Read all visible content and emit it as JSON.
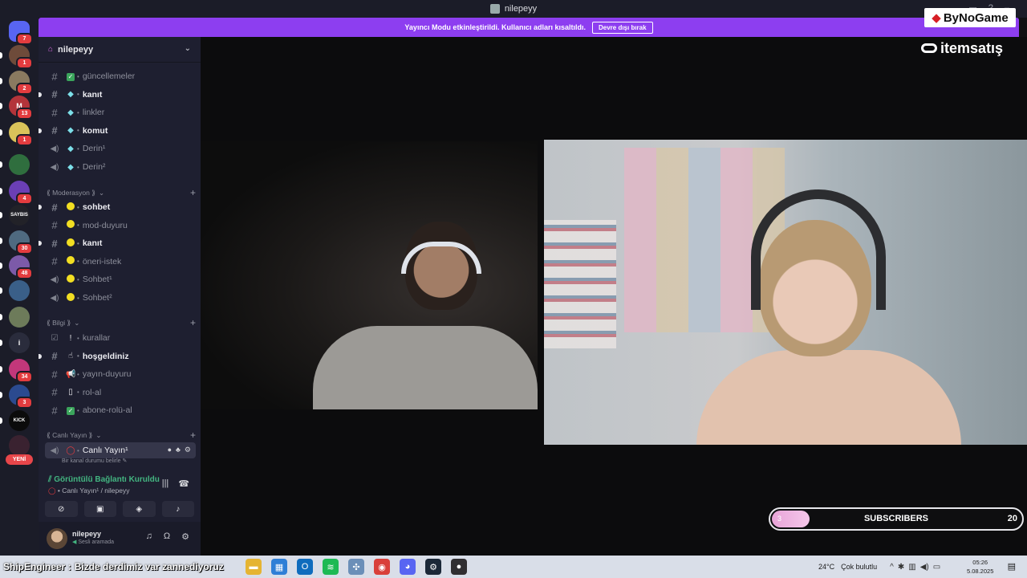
{
  "window": {
    "title": "nilepeyy"
  },
  "banner": {
    "message": "Yayıncı Modu etkinleştirildi. Kullanıcı adları kısaltıldı.",
    "button": "Devre dışı bırak"
  },
  "rail": {
    "servers": [
      {
        "initial": "",
        "badge": "7",
        "color": "#5865f2"
      },
      {
        "initial": "",
        "badge": "1",
        "color": "#6e4b3a"
      },
      {
        "initial": "",
        "badge": "2",
        "color": "#8a7a60"
      },
      {
        "initial": "M",
        "badge": "13",
        "color": "#b3343a"
      },
      {
        "initial": "",
        "badge": "1",
        "color": "#d9c35a"
      },
      {
        "initial": "",
        "badge": "",
        "color": "#2f6e3e"
      },
      {
        "initial": "",
        "badge": "4",
        "color": "#6b3fb5"
      },
      {
        "initial": "SAYBIS",
        "badge": "",
        "color": "#222228"
      },
      {
        "initial": "",
        "badge": "30",
        "color": "#4f6a80"
      },
      {
        "initial": "",
        "badge": "48",
        "color": "#7c5aa8"
      },
      {
        "initial": "",
        "badge": "",
        "color": "#3a5f88"
      },
      {
        "initial": "",
        "badge": "",
        "color": "#6d7b5a"
      },
      {
        "initial": "i",
        "badge": "",
        "color": "#2a2c3c"
      },
      {
        "initial": "",
        "badge": "34",
        "color": "#c2377a"
      },
      {
        "initial": "",
        "badge": "3",
        "color": "#2b4a8f"
      },
      {
        "initial": "KICK",
        "badge": "",
        "color": "#0b0b0b"
      },
      {
        "initial": "",
        "badge": "",
        "color": "#3a2230"
      }
    ],
    "new_label": "YENİ"
  },
  "sidebar": {
    "server_name": "nilepeyy",
    "channels_top": [
      {
        "name": "güncellemeler",
        "kind": "text",
        "emoji": "check",
        "bold": false
      },
      {
        "name": "kanıt",
        "kind": "text",
        "emoji": "gem",
        "bold": true
      },
      {
        "name": "linkler",
        "kind": "text",
        "emoji": "gem",
        "bold": false
      },
      {
        "name": "komut",
        "kind": "text",
        "emoji": "gem",
        "bold": true
      },
      {
        "name": "Derin¹",
        "kind": "voice",
        "emoji": "gem",
        "bold": false
      },
      {
        "name": "Derin²",
        "kind": "voice",
        "emoji": "gem",
        "bold": false
      }
    ],
    "categories": {
      "moderasyon": "⟪ Moderasyon ⟫",
      "bilgi": "⟪ Bilgi ⟫",
      "canli": "⟪ Canlı Yayın ⟫"
    },
    "channels_mod": [
      {
        "name": "sohbet",
        "kind": "text",
        "bold": true
      },
      {
        "name": "mod-duyuru",
        "kind": "text",
        "bold": false
      },
      {
        "name": "kanıt",
        "kind": "text",
        "bold": true
      },
      {
        "name": "öneri-istek",
        "kind": "text",
        "bold": false
      },
      {
        "name": "Sohbet¹",
        "kind": "voice",
        "bold": false
      },
      {
        "name": "Sohbet²",
        "kind": "voice",
        "bold": false
      }
    ],
    "channels_info": [
      {
        "name": "kurallar",
        "kind": "rules",
        "emoji": "!",
        "bold": false
      },
      {
        "name": "hoşgeldiniz",
        "kind": "text",
        "emoji": "☝",
        "bold": true
      },
      {
        "name": "yayın-duyuru",
        "kind": "text",
        "emoji": "📢",
        "bold": false
      },
      {
        "name": "rol-al",
        "kind": "text",
        "emoji": "▯",
        "bold": false
      },
      {
        "name": "abone-rolü-al",
        "kind": "text",
        "emoji": "check",
        "bold": false
      }
    ],
    "live_channel": {
      "name": "Canlı Yayın¹",
      "status": "Bir kanal durumu belirle"
    },
    "voice": {
      "title": "Görüntülü Bağlantı Kuruldu",
      "subtitle": "Canlı Yayın¹ / nilepeyy"
    },
    "user": {
      "name": "nilepeyy",
      "status": "Sesli aramada"
    }
  },
  "overlay": {
    "logo1": "ByNoGame",
    "logo2": "itemsatış",
    "subscribers": {
      "label": "SUBSCRIBERS",
      "current": 3,
      "goal": 20
    }
  },
  "taskbar": {
    "ticker_user": "ShipEngineer :",
    "ticker_text": "Bizde derdimiz var zannediyoruz",
    "weather_temp": "24°C",
    "weather_text": "Çok bulutlu",
    "time": "05:26",
    "date": "5.08.2025",
    "apps": [
      {
        "icon": "folder-icon",
        "color": "#e5b432",
        "glyph": "▬"
      },
      {
        "icon": "store-icon",
        "color": "#2f7fd6",
        "glyph": "▦"
      },
      {
        "icon": "outlook-icon",
        "color": "#0f6cbd",
        "glyph": "O"
      },
      {
        "icon": "spotify-icon",
        "color": "#1db954",
        "glyph": "≋"
      },
      {
        "icon": "network-icon",
        "color": "#6b8fb8",
        "glyph": "✣"
      },
      {
        "icon": "chrome-icon",
        "color": "#d9403a",
        "glyph": "◉"
      },
      {
        "icon": "discord-icon",
        "color": "#5865f2",
        "glyph": "◕"
      },
      {
        "icon": "steam-icon",
        "color": "#1b2838",
        "glyph": "⚙"
      },
      {
        "icon": "obs-icon",
        "color": "#302e31",
        "glyph": "●"
      }
    ]
  },
  "colors": {
    "accent": "#8d3ef0",
    "sidebar": "#1e1f30",
    "rail": "#1b1c28",
    "voice_green": "#43b581"
  }
}
